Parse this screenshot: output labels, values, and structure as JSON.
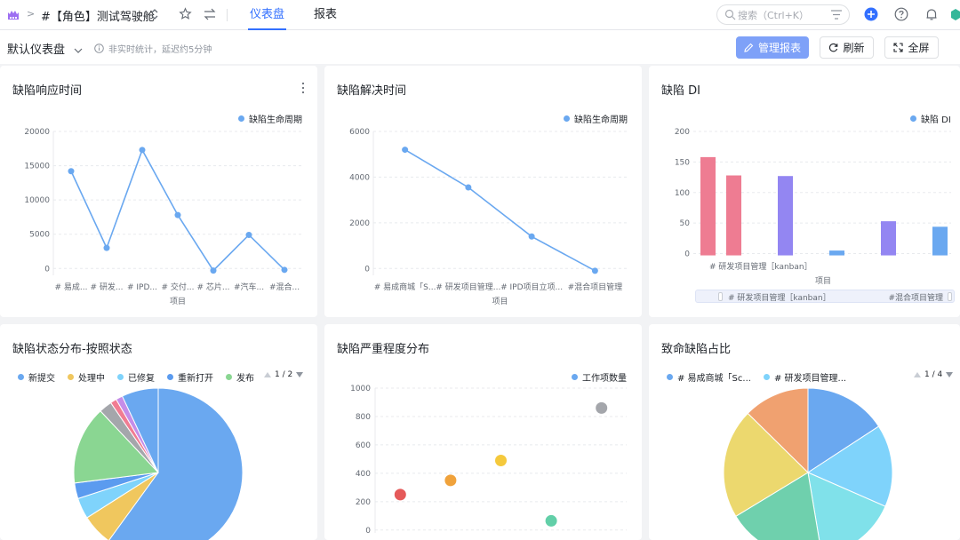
{
  "topbar": {
    "project_name": "#【角色】测试驾驶舱",
    "tabs": [
      {
        "label": "仪表盘",
        "active": true
      },
      {
        "label": "报表",
        "active": false
      }
    ],
    "search_placeholder": "搜索（Ctrl+K）",
    "accent_color": "#3370ff"
  },
  "subbar": {
    "dashboard_name": "默认仪表盘",
    "info_text": "非实时统计，延迟约5分钟",
    "manage_label": "管理报表",
    "refresh_label": "刷新",
    "fullscreen_label": "全屏"
  },
  "cards": {
    "response_time": {
      "title": "缺陷响应时间",
      "legend": "缺陷生命周期",
      "xlabel": "项目"
    },
    "resolve_time": {
      "title": "缺陷解决时间",
      "legend": "缺陷生命周期",
      "xlabel": "项目"
    },
    "di": {
      "title": "缺陷 DI",
      "legend": "缺陷 DI",
      "xlabel": "项目",
      "tick_label": "# 研发项目管理［kanban］",
      "scroll_left": "# 研发项目管理［kanban］",
      "scroll_right": "#混合项目管理"
    },
    "status": {
      "title": "缺陷状态分布-按照状态",
      "pager": "1 / 2"
    },
    "severity": {
      "title": "缺陷严重程度分布",
      "legend": "工作项数量"
    },
    "fatal": {
      "title": "致命缺陷占比",
      "pager": "1 / 4"
    }
  },
  "chart_data": [
    {
      "type": "line",
      "title": "缺陷响应时间",
      "xlabel": "项目",
      "categories": [
        "# 易成...",
        "# 研发...",
        "# IPD...",
        "# 交付...",
        "# 芯片...",
        "#汽车...",
        "#混合..."
      ],
      "series": [
        {
          "name": "缺陷生命周期",
          "values": [
            14200,
            3000,
            17300,
            7800,
            -300,
            4900,
            -200
          ]
        }
      ],
      "yticks": [
        0,
        5000,
        10000,
        15000,
        20000
      ],
      "ylim": [
        -1000,
        20000
      ],
      "color": "#6aa8f0"
    },
    {
      "type": "line",
      "title": "缺陷解决时间",
      "xlabel": "项目",
      "categories": [
        "# 易成商城「S...",
        "# 研发项目管理...",
        "# IPD项目立项...",
        "#混合项目管理"
      ],
      "series": [
        {
          "name": "缺陷生命周期",
          "values": [
            5200,
            3550,
            1400,
            -100
          ]
        }
      ],
      "yticks": [
        0,
        2000,
        4000,
        6000
      ],
      "ylim": [
        -300,
        6000
      ],
      "color": "#6aa8f0"
    },
    {
      "type": "bar",
      "title": "缺陷 DI",
      "xlabel": "项目",
      "values": [
        158,
        128,
        0,
        127,
        0,
        5,
        0,
        53,
        0,
        44
      ],
      "colors": [
        "#ee7c92",
        "#ee7c92",
        "#ee7c92",
        "#9386f2",
        "#9386f2",
        "#6aa8f0",
        "#6aa8f0",
        "#9386f2",
        "#9386f2",
        "#6aa8f0"
      ],
      "series": [
        {
          "name": "缺陷 DI"
        }
      ],
      "yticks": [
        0,
        50,
        100,
        150,
        200
      ],
      "ylim": [
        -5,
        200
      ]
    },
    {
      "type": "pie",
      "title": "缺陷状态分布-按照状态",
      "legend": [
        {
          "label": "新提交",
          "color": "#6aa8f0"
        },
        {
          "label": "处理中",
          "color": "#f0c75e"
        },
        {
          "label": "已修复",
          "color": "#7fd3fb"
        },
        {
          "label": "重新打开",
          "color": "#5b9bef"
        },
        {
          "label": "发布",
          "color": "#8ad692"
        }
      ],
      "slices": [
        {
          "value": 60,
          "color": "#6aa8f0"
        },
        {
          "value": 6,
          "color": "#f0c75e"
        },
        {
          "value": 4,
          "color": "#7fd3fb"
        },
        {
          "value": 3,
          "color": "#5b9bef"
        },
        {
          "value": 15,
          "color": "#8ad692"
        },
        {
          "value": 2.5,
          "color": "#a4a6ab"
        },
        {
          "value": 1.2,
          "color": "#f07c92"
        },
        {
          "value": 1.3,
          "color": "#c58de8"
        },
        {
          "value": 7,
          "color": "#6aa8f0"
        }
      ]
    },
    {
      "type": "scatter",
      "title": "缺陷严重程度分布",
      "series": [
        {
          "name": "工作项数量"
        }
      ],
      "points": [
        {
          "x": 1,
          "y": 250,
          "color": "#e55a5a"
        },
        {
          "x": 2,
          "y": 350,
          "color": "#f0a23b"
        },
        {
          "x": 3,
          "y": 490,
          "color": "#f5c93c"
        },
        {
          "x": 4,
          "y": 65,
          "color": "#62cfa8"
        },
        {
          "x": 5,
          "y": 860,
          "color": "#a4a6ab"
        }
      ],
      "yticks": [
        0,
        200,
        400,
        600,
        800,
        1000
      ],
      "ylim": [
        -20,
        1000
      ]
    },
    {
      "type": "pie",
      "title": "致命缺陷占比",
      "legend": [
        {
          "label": "# 易成商城「Sc...",
          "color": "#6aa8f0"
        },
        {
          "label": "# 研发项目管理...",
          "color": "#7fd3fb"
        }
      ],
      "slices": [
        {
          "value": 15,
          "color": "#6aa8f0"
        },
        {
          "value": 15,
          "color": "#7fd3fb"
        },
        {
          "value": 15,
          "color": "#80e1ea"
        },
        {
          "value": 18,
          "color": "#6fd0ad"
        },
        {
          "value": 20,
          "color": "#ecd86e"
        },
        {
          "value": 12,
          "color": "#f0a170"
        }
      ]
    }
  ]
}
